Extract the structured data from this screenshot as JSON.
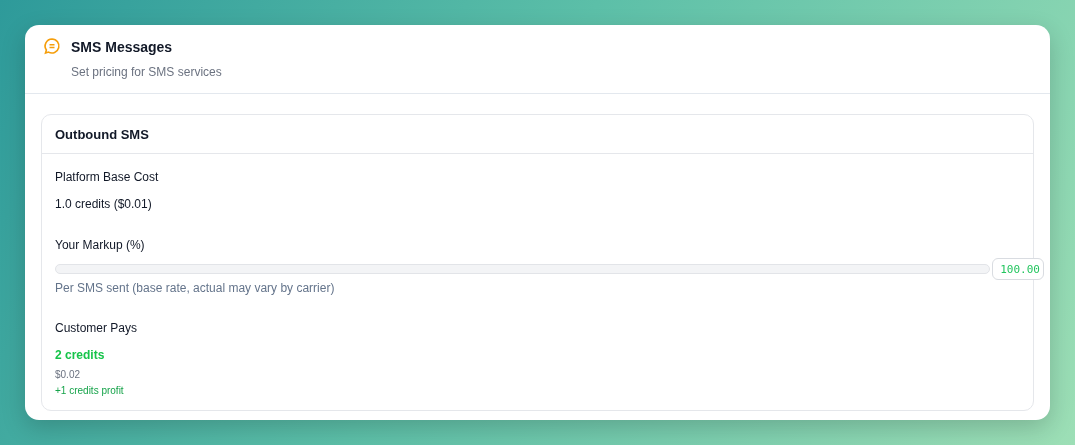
{
  "header": {
    "title": "SMS Messages",
    "subtitle": "Set pricing for SMS services"
  },
  "section": {
    "title": "Outbound SMS",
    "base_cost": {
      "label": "Platform Base Cost",
      "value": "1.0 credits ($0.01)"
    },
    "markup": {
      "label": "Your Markup (%)",
      "value": "100.00",
      "hint": "Per SMS sent (base rate, actual may vary by carrier)"
    },
    "customer_pays": {
      "label": "Customer Pays",
      "credits": "2 credits",
      "price": "$0.02",
      "profit": "+1 credits profit"
    }
  }
}
